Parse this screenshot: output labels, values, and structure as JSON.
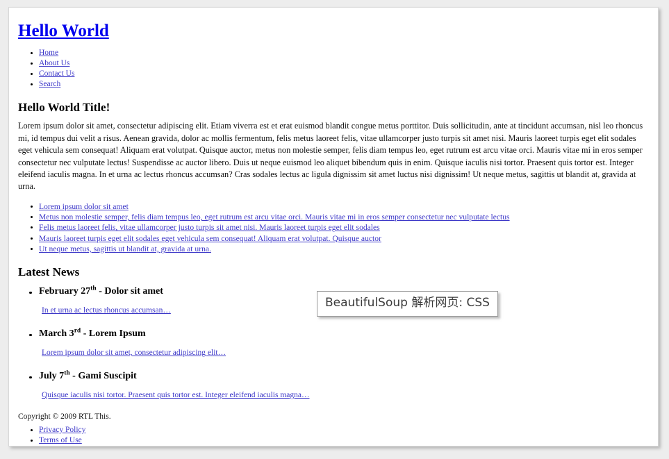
{
  "site": {
    "title": "Hello World"
  },
  "nav": {
    "items": [
      {
        "label": "Home"
      },
      {
        "label": "About Us"
      },
      {
        "label": "Contact Us"
      },
      {
        "label": "Search"
      }
    ]
  },
  "main": {
    "heading": "Hello World Title!",
    "paragraph": "Lorem ipsum dolor sit amet, consectetur adipiscing elit. Etiam viverra est et erat euismod blandit congue metus porttitor. Duis sollicitudin, ante at tincidunt accumsan, nisl leo rhoncus mi, id tempus dui velit a risus. Aenean gravida, dolor ac mollis fermentum, felis metus laoreet felis, vitae ullamcorper justo turpis sit amet nisi. Mauris laoreet turpis eget elit sodales eget vehicula sem consequat! Aliquam erat volutpat. Quisque auctor, metus non molestie semper, felis diam tempus leo, eget rutrum est arcu vitae orci. Mauris vitae mi in eros semper consectetur nec vulputate lectus! Suspendisse ac auctor libero. Duis ut neque euismod leo aliquet bibendum quis in enim. Quisque iaculis nisi tortor. Praesent quis tortor est. Integer eleifend iaculis magna. In et urna ac lectus rhoncus accumsan? Cras sodales lectus ac ligula dignissim sit amet luctus nisi dignissim! Ut neque metus, sagittis ut blandit at, gravida at urna.",
    "links": [
      {
        "label": "Lorem ipsum dolor sit amet"
      },
      {
        "label": "Metus non molestie semper, felis diam tempus leo, eget rutrum est arcu vitae orci. Mauris vitae mi in eros semper consectetur nec vulputate lectus"
      },
      {
        "label": "Felis metus laoreet felis, vitae ullamcorper justo turpis sit amet nisi. Mauris laoreet turpis eget elit sodales"
      },
      {
        "label": "Mauris laoreet turpis eget elit sodales eget vehicula sem consequat! Aliquam erat volutpat. Quisque auctor"
      },
      {
        "label": "Ut neque metus, sagittis ut blandit at, gravida at urna."
      }
    ]
  },
  "news": {
    "heading": "Latest News",
    "items": [
      {
        "month_day": "February 27",
        "ordinal": "th",
        "separator": " - ",
        "title": "Dolor sit amet",
        "excerpt": "In et urna ac lectus rhoncus accumsan…"
      },
      {
        "month_day": "March 3",
        "ordinal": "rd",
        "separator": " - ",
        "title": "Lorem Ipsum",
        "excerpt": "Lorem ipsum dolor sit amet, consectetur adipiscing elit…"
      },
      {
        "month_day": "July 7",
        "ordinal": "th",
        "separator": " - ",
        "title": "Gami Suscipit",
        "excerpt": "Quisque iaculis nisi tortor. Praesent quis tortor est. Integer eleifend iaculis magna…"
      }
    ]
  },
  "footer": {
    "copyright": "Copyright © 2009 RTL This.",
    "links": [
      {
        "label": "Privacy Policy"
      },
      {
        "label": "Terms of Use"
      }
    ]
  },
  "overlay": {
    "text": "BeautifulSoup 解析网页: CSS"
  },
  "colors": {
    "link": "#3c37c8",
    "title_link": "#0000ee",
    "page_background": "#ffffff",
    "canvas_background": "#ededed",
    "overlay_border": "#9a9a9a",
    "overlay_text": "#3b3b3b"
  }
}
